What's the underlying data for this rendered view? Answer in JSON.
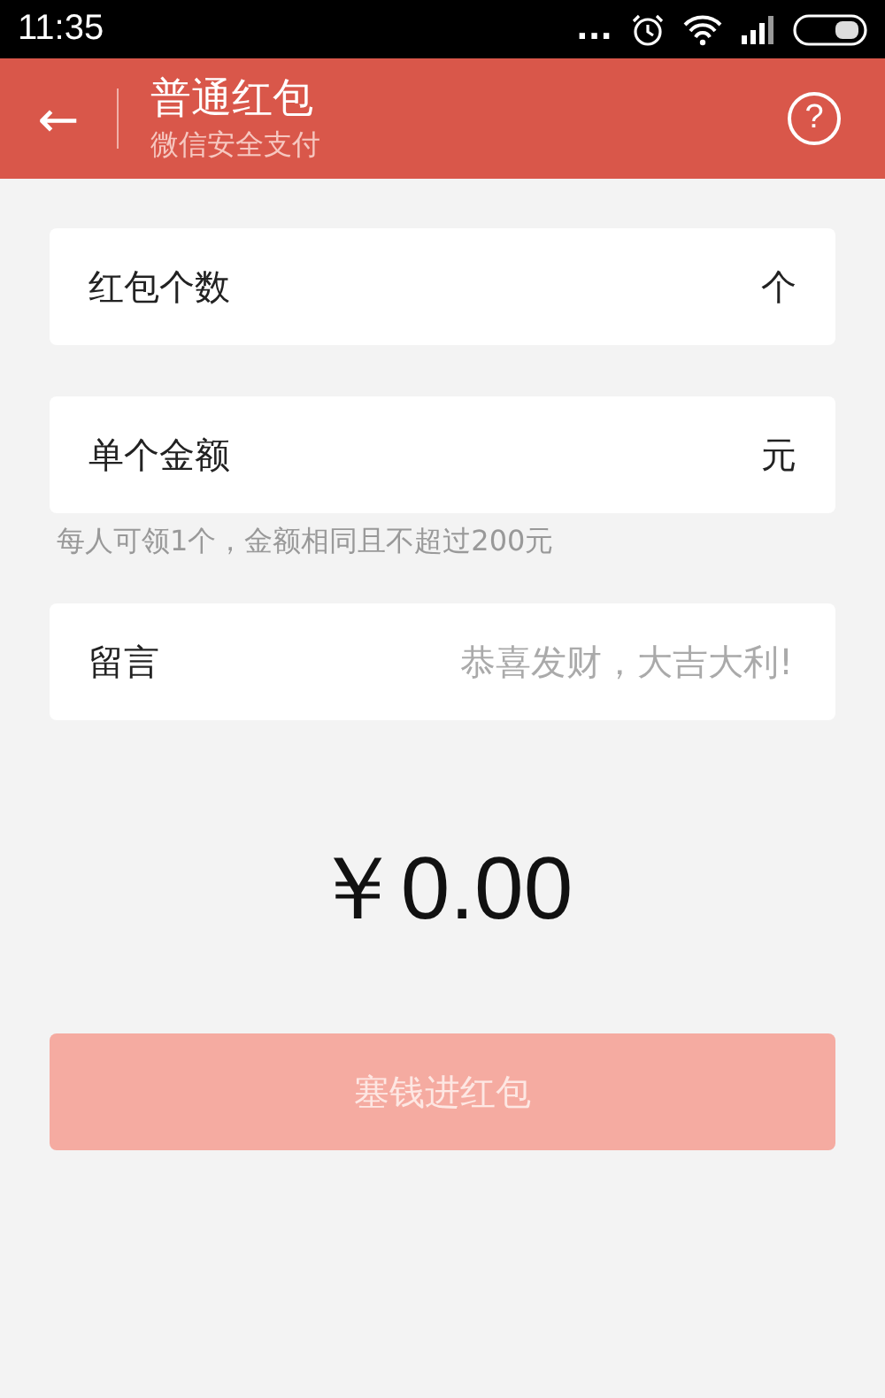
{
  "status_bar": {
    "time": "11:35",
    "more": "..."
  },
  "header": {
    "back": "←",
    "title": "普通红包",
    "subtitle": "微信安全支付",
    "help": "?"
  },
  "fields": [
    {
      "label": "红包个数",
      "unit": "个"
    },
    {
      "label": "单个金额",
      "unit": "元",
      "hint": "每人可领1个，金额相同且不超过200元"
    },
    {
      "label": "留言",
      "placeholder": "恭喜发财，大吉大利!"
    }
  ],
  "amount": "￥0.00",
  "submit": {
    "label": "塞钱进红包",
    "disabled": true
  }
}
